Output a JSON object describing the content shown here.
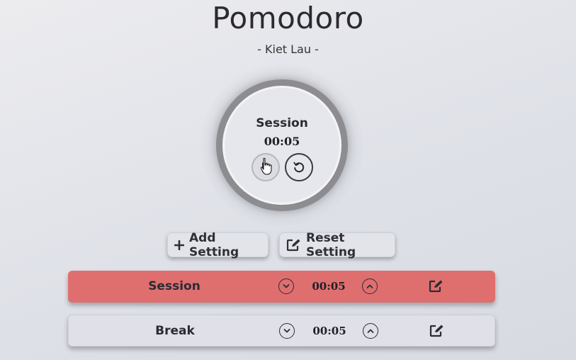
{
  "app": {
    "title": "Pomodoro",
    "author": "- Kiet Lau -"
  },
  "timer": {
    "label": "Session",
    "time": "00:05"
  },
  "icons": {
    "play": "play-icon",
    "reset": "reset-icon",
    "cursor": "hand-pointer-icon",
    "plus": "plus-icon",
    "edit": "edit-icon",
    "chevron_down": "chevron-down-icon",
    "chevron_up": "chevron-up-icon"
  },
  "actions": {
    "add_label": "Add Setting",
    "reset_label": "Reset Setting"
  },
  "settings": [
    {
      "name": "Session",
      "time": "00:05",
      "active": true,
      "color": "#df6f6f"
    },
    {
      "name": "Break",
      "time": "00:05",
      "active": false,
      "color": "#e0e1e8"
    }
  ]
}
